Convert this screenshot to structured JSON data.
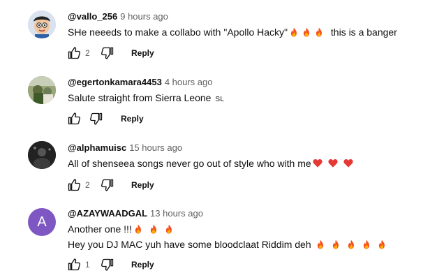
{
  "comments": [
    {
      "handle": "@vallo_256",
      "time": "9 hours ago",
      "text": "SHe neeeds to make a collabo with \"Apollo Hacky\"",
      "text_tail": "this is a banger",
      "fires_inline": 3,
      "likes": "2",
      "reply_label": "Reply",
      "avatar": "cartoon-avatar"
    },
    {
      "handle": "@egertonkamara4453",
      "time": "4 hours ago",
      "text": "Salute straight from Sierra Leone",
      "flag": "SL",
      "likes": "",
      "reply_label": "Reply",
      "avatar": "photo-avatar"
    },
    {
      "handle": "@alphamuisc",
      "time": "15 hours ago",
      "text": "All of shenseea songs never go out of style who with me",
      "hearts": 3,
      "likes": "2",
      "reply_label": "Reply",
      "avatar": "dark-photo-avatar"
    },
    {
      "handle": "@AZAYWAADGAL",
      "time": "13 hours ago",
      "text": "Another one !!!",
      "text2": "Hey you DJ MAC yuh have some bloodclaat Riddim deh",
      "fires_line1": 3,
      "fires_line2": 5,
      "likes": "1",
      "reply_label": "Reply",
      "avatar_letter": "A",
      "avatar_color": "#7e57c2"
    }
  ],
  "colors": {
    "fire": "#f4511e",
    "heart": "#e53935",
    "muted": "#606060"
  },
  "icons": [
    "thumb-up-icon",
    "thumb-down-icon",
    "fire-emoji-icon",
    "heart-emoji-icon"
  ]
}
